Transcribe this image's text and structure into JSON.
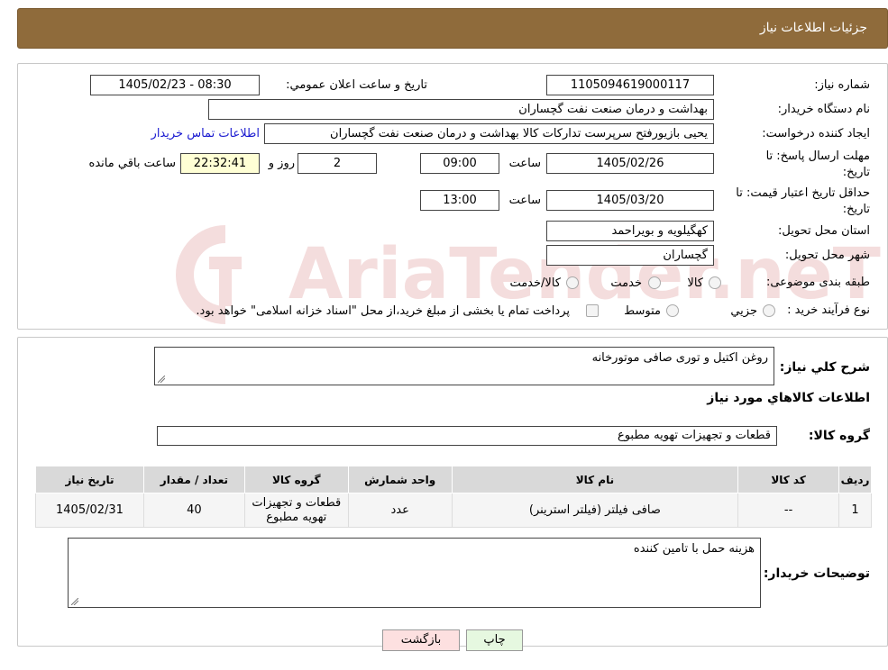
{
  "header": {
    "title": "جزئیات اطلاعات نیاز"
  },
  "watermark": {
    "text": "AriaTender.neT"
  },
  "form": {
    "need_number_label": "شماره نیاز:",
    "need_number": "1105094619000117",
    "announce_label": "تاریخ و ساعت اعلان عمومي:",
    "announce_value": "1405/02/23 - 08:30",
    "buyer_org_label": "نام دستگاه خريدار:",
    "buyer_org": "بهداشت و درمان صنعت نفت گچساران",
    "creator_label": "ايجاد کننده درخواست:",
    "creator": "يحيی بازيورفتح سرپرست تداركات كالا  بهداشت و درمان صنعت نفت گچساران",
    "contact_link": "اطلاعات تماس خريدار",
    "deadline_label_1": "مهلت ارسال پاسخ: تا",
    "deadline_label_2": "تاریخ:",
    "deadline_date": "1405/02/26",
    "time_label": "ساعت",
    "deadline_time": "09:00",
    "days_value": "2",
    "days_label": "روز و",
    "remaining_time": "22:32:41",
    "remaining_label": "ساعت باقي مانده",
    "validity_label_1": "حداقل تاريخ اعتبار قيمت: تا",
    "validity_label_2": "تاریخ:",
    "validity_date": "1405/03/20",
    "validity_time": "13:00",
    "province_label": "استان محل تحويل:",
    "province": "کهگيلويه و بويراحمد",
    "city_label": "شهر محل تحويل:",
    "city": "گچساران",
    "category_label": "طبقه بندی موضوعی:",
    "category_options": [
      "كالا",
      "خدمت",
      "كالا/خدمت"
    ],
    "process_label": "نوع فرآيند خريد :",
    "process_options": [
      "جزيي",
      "متوسط"
    ],
    "process_note": "پرداخت تمام يا بخشی از مبلغ خريد،از محل \"اسناد خزانه اسلامی\" خواهد بود."
  },
  "details": {
    "summary_label": "شرح کلي نياز:",
    "summary": "روغن اکتیل و توری صافی موتورخانه",
    "goods_info_title": "اطلاعات کالاهاي مورد نياز",
    "group_label": "گروه کالا:",
    "group_value": "قطعات و تجهیزات تهویه مطبوع",
    "table": {
      "headers": [
        "رديف",
        "کد کالا",
        "نام کالا",
        "واحد شمارش",
        "گروه کالا",
        "تعداد / مقدار",
        "تاريخ نياز"
      ],
      "rows": [
        [
          "1",
          "--",
          "صافی فیلتر (فیلتر استرینر)",
          "عدد",
          "قطعات و تجهيزات تهويه مطبوع",
          "40",
          "1405/02/31"
        ]
      ]
    },
    "buyer_notes_label": "توضيحات خريدار:",
    "buyer_notes": "هزینه حمل با تامین کننده"
  },
  "buttons": {
    "print": "چاپ",
    "back": "بازگشت"
  },
  "colors": {
    "header_bg": "#8f6b3b",
    "link": "#1a1ad0",
    "back_btn": "#fde0e0",
    "print_btn": "#e6f8e0",
    "remaining_bg": "#ffffd5"
  }
}
